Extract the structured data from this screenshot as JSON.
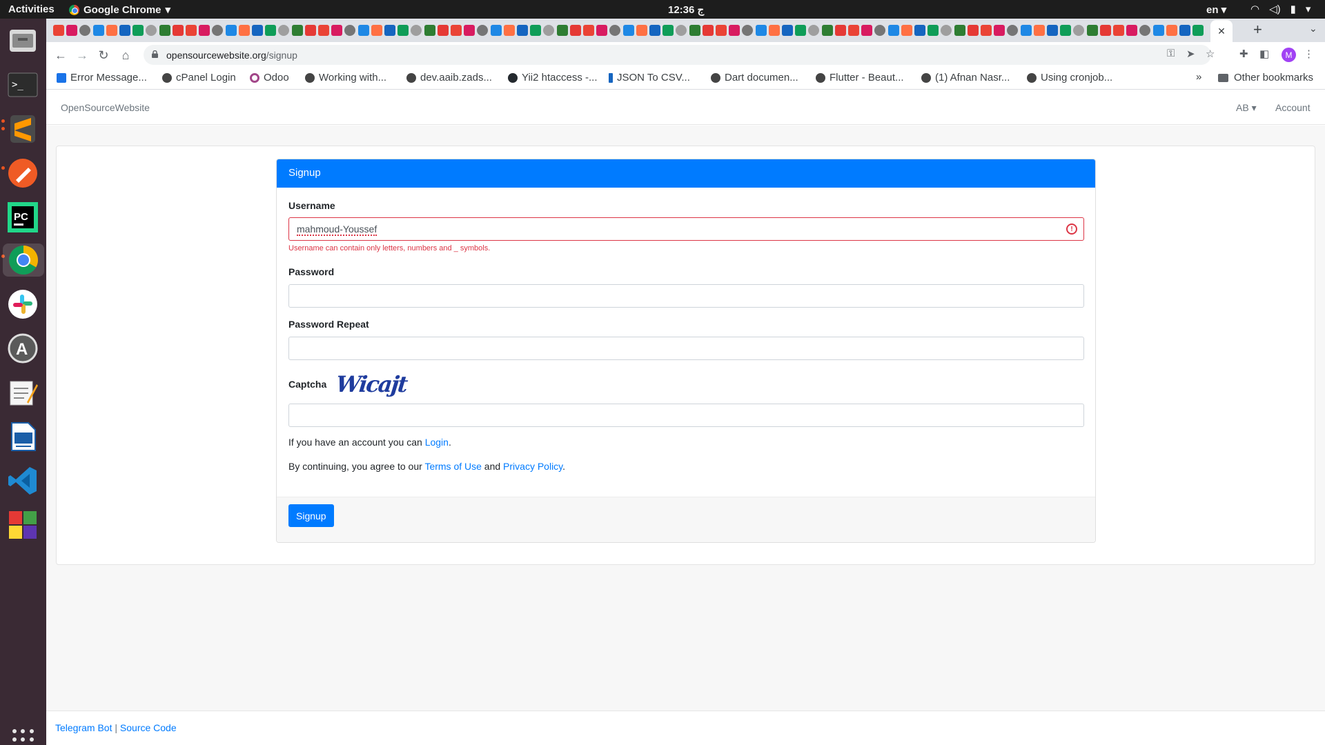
{
  "os": {
    "activities": "Activities",
    "app_name": "Google Chrome",
    "clock": "12:36 ج",
    "language": "en"
  },
  "dock": {
    "apps": [
      "files-icon",
      "terminal-icon",
      "sublime-text-icon",
      "postman-icon",
      "pycharm-icon",
      "chrome-icon",
      "slack-icon",
      "software-updater-icon",
      "text-editor-icon",
      "libreoffice-writer-icon",
      "vscode-icon",
      "app-grid-extra-icon"
    ]
  },
  "browser": {
    "url_host": "opensourcewebsite.org",
    "url_path": "/signup",
    "profile_initial": "M",
    "bookmarks": [
      {
        "label": "Error Message..."
      },
      {
        "label": "cPanel Login"
      },
      {
        "label": "Odoo"
      },
      {
        "label": "Working with..."
      },
      {
        "label": "dev.aaib.zads..."
      },
      {
        "label": "Yii2 htaccess -..."
      },
      {
        "label": "JSON To CSV..."
      },
      {
        "label": "Dart documen..."
      },
      {
        "label": "Flutter - Beaut..."
      },
      {
        "label": "(1) Afnan Nasr..."
      },
      {
        "label": "Using cronjob..."
      }
    ],
    "bookmarks_more": "»",
    "other_bookmarks": "Other bookmarks"
  },
  "site": {
    "brand": "OpenSourceWebsite",
    "lang_menu": "AB",
    "account": "Account"
  },
  "form": {
    "header": "Signup",
    "username_label": "Username",
    "username_value": "mahmoud-Youssef",
    "username_error": "Username can contain only letters, numbers and _ symbols.",
    "password_label": "Password",
    "password_repeat_label": "Password Repeat",
    "captcha_label": "Captcha",
    "captcha_text": "Wicajt",
    "login_prefix": "If you have an account you can",
    "login_link": "Login",
    "login_suffix": ".",
    "terms_prefix": "By continuing, you agree to our",
    "terms_link": "Terms of Use",
    "terms_and": "and",
    "privacy_link": "Privacy Policy",
    "terms_suffix": ".",
    "submit": "Signup"
  },
  "footer": {
    "telegram": "Telegram Bot",
    "separator": "|",
    "source": "Source Code"
  },
  "colors": {
    "primary": "#007bff",
    "danger": "#dc3545",
    "dock_bg": "#3a2a34"
  }
}
